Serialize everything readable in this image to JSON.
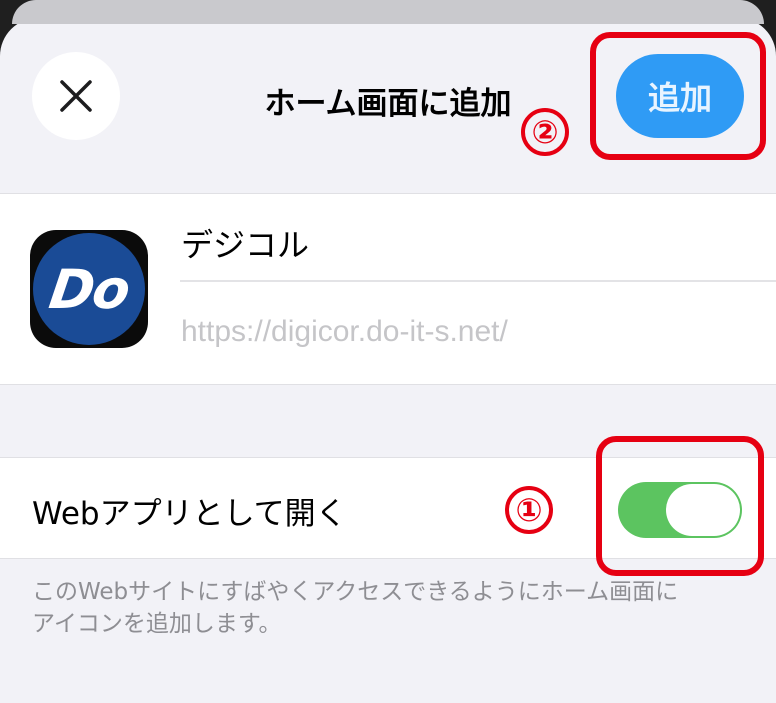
{
  "header": {
    "close_icon": "close-x-icon",
    "title": "ホーム画面に追加",
    "add_label": "追加"
  },
  "markers": {
    "one": "①",
    "two": "②",
    "color": "#e60012"
  },
  "app": {
    "icon_text": "Do",
    "name": "デジコル",
    "url": "https://digicor.do-it-s.net/"
  },
  "web_app_toggle": {
    "label": "Webアプリとして開く",
    "checked": true,
    "on_color": "#5cc460"
  },
  "footnote": {
    "line1": "このWebサイトにすばやくアクセスできるようにホーム画面に",
    "line2": "アイコンを追加します。"
  },
  "colors": {
    "accent": "#2f9bf5",
    "sheet_background": "#f2f2f7"
  }
}
